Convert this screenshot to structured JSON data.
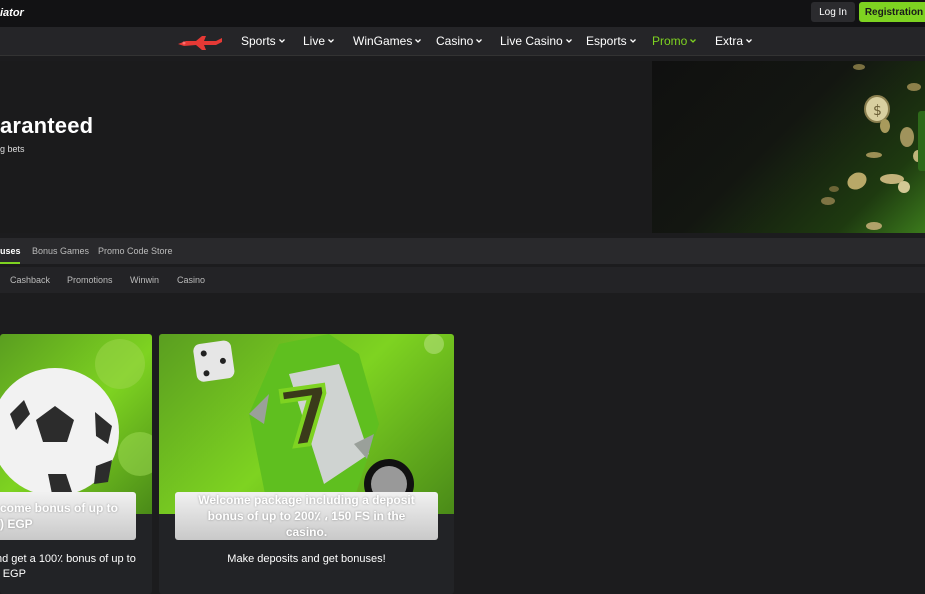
{
  "header": {
    "logo_text": "iator",
    "login_label": "Log In",
    "registration_label": "Registration",
    "brand_accent": "#7ed321"
  },
  "nav": {
    "items": [
      {
        "label": "Sports",
        "active": false
      },
      {
        "label": "Live",
        "active": false
      },
      {
        "label": "WinGames",
        "active": false
      },
      {
        "label": "Casino",
        "active": false
      },
      {
        "label": "Live Casino",
        "active": false
      },
      {
        "label": "Esports",
        "active": false
      },
      {
        "label": "Promo",
        "active": true
      },
      {
        "label": "Extra",
        "active": false
      }
    ]
  },
  "hero": {
    "title": "aranteed",
    "subtitle": "g bets"
  },
  "tabs_primary": [
    {
      "label": "uses",
      "active": true
    },
    {
      "label": "Bonus Games",
      "active": false
    },
    {
      "label": "Promo Code Store",
      "active": false
    }
  ],
  "tabs_secondary": [
    {
      "label": "Cashback"
    },
    {
      "label": "Promotions"
    },
    {
      "label": "Winwin"
    },
    {
      "label": "Casino"
    }
  ],
  "cards": [
    {
      "title": "come bonus of up to\n) EGP",
      "description": "nd get a 100٪ bonus of up to\n) EGP"
    },
    {
      "title": "Welcome package including a deposit\nbonus of up to 200٪ ، 150 FS in the\ncasino.",
      "description": "Make deposits and get bonuses!"
    }
  ]
}
